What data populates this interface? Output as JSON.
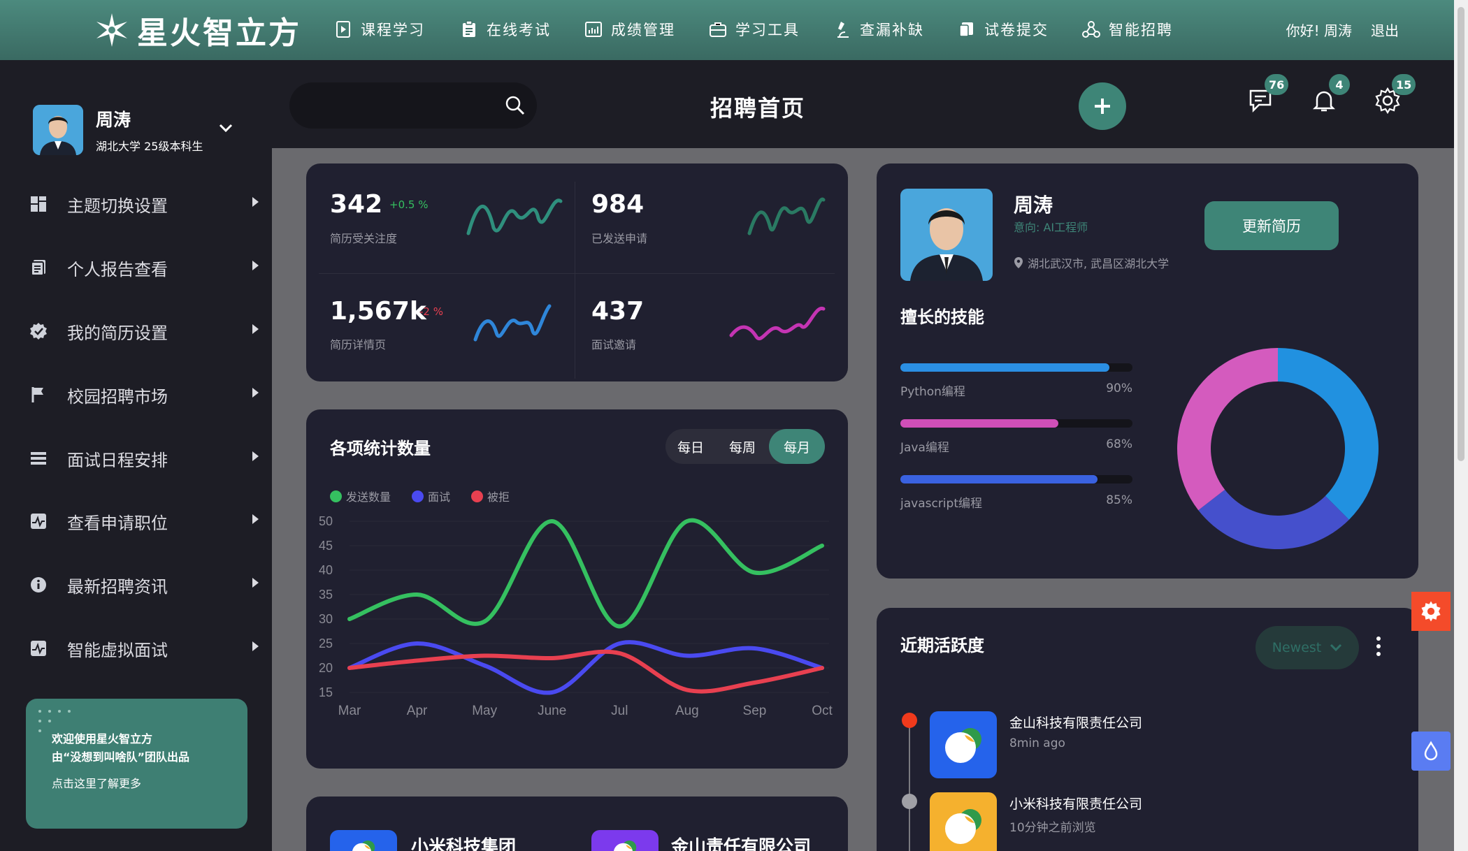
{
  "brand": {
    "name": "星火智立方"
  },
  "nav": {
    "items": [
      {
        "label": "课程学习",
        "icon": "play-doc-icon"
      },
      {
        "label": "在线考试",
        "icon": "clipboard-icon"
      },
      {
        "label": "成绩管理",
        "icon": "chart-icon"
      },
      {
        "label": "学习工具",
        "icon": "toolbox-icon"
      },
      {
        "label": "查漏补缺",
        "icon": "microscope-icon"
      },
      {
        "label": "试卷提交",
        "icon": "submit-icon"
      },
      {
        "label": "智能招聘",
        "icon": "network-icon"
      }
    ],
    "greeting": "你好! 周涛",
    "logout": "退出"
  },
  "sidebar": {
    "user": {
      "name": "周涛",
      "school": "湖北大学 25级本科生"
    },
    "items": [
      {
        "label": "主题切换设置",
        "icon": "grid-icon"
      },
      {
        "label": "个人报告查看",
        "icon": "document-icon"
      },
      {
        "label": "我的简历设置",
        "icon": "badge-check-icon"
      },
      {
        "label": "校园招聘市场",
        "icon": "flag-icon"
      },
      {
        "label": "面试日程安排",
        "icon": "list-icon"
      },
      {
        "label": "查看申请职位",
        "icon": "activity-icon"
      },
      {
        "label": "最新招聘资讯",
        "icon": "info-icon"
      },
      {
        "label": "智能虚拟面试",
        "icon": "activity-icon"
      }
    ],
    "promo": {
      "line1": "欢迎使用星火智立方",
      "line2": "由“没想到叫啥队”团队出品",
      "line3": "点击这里了解更多"
    }
  },
  "header": {
    "search_placeholder": "",
    "title": "招聘首页",
    "badges": {
      "messages": "76",
      "notifications": "4",
      "settings": "15"
    }
  },
  "stats": [
    {
      "value": "342",
      "delta": "+0.5 %",
      "label": "简历受关注度",
      "color": "#2f8f7d"
    },
    {
      "value": "984",
      "delta": "",
      "label": "已发送申请",
      "color": "#2a7a63"
    },
    {
      "value": "1,567k",
      "delta": "-2 %",
      "label": "简历详情页",
      "color": "#2f86d9"
    },
    {
      "value": "437",
      "delta": "",
      "label": "面试邀请",
      "color": "#c434b3"
    }
  ],
  "chart_card": {
    "title": "各项统计数量",
    "tabs": [
      "每日",
      "每周",
      "每月"
    ],
    "active_tab": "每月"
  },
  "chart_data": {
    "type": "line",
    "categories": [
      "Mar",
      "Apr",
      "May",
      "June",
      "Jul",
      "Aug",
      "Sep",
      "Oct"
    ],
    "yticks": [
      50,
      45,
      40,
      35,
      30,
      25,
      20,
      15
    ],
    "ylim": [
      15,
      50
    ],
    "grid": true,
    "legend_position": "top-left",
    "series": [
      {
        "name": "发送数量",
        "color": "#35c060",
        "values": [
          30,
          35,
          29.5,
          50,
          28.5,
          50,
          39.5,
          45
        ]
      },
      {
        "name": "面试",
        "color": "#4a4af0",
        "values": [
          20,
          25,
          20.5,
          15,
          25,
          22.5,
          24,
          20
        ]
      },
      {
        "name": "被拒",
        "color": "#e84050",
        "values": [
          20,
          21.5,
          22.5,
          22,
          23,
          15.5,
          17,
          20
        ]
      }
    ]
  },
  "resume": {
    "name": "周涛",
    "intent": "意向: AI工程师",
    "location": "湖北武汉市, 武昌区湖北大学",
    "update_button": "更新简历",
    "skills_title": "擅长的技能",
    "skills": [
      {
        "name": "Python编程",
        "pct_text": "90%",
        "pct": 0.9,
        "color": "#2b8fe3"
      },
      {
        "name": "Java编程",
        "pct_text": "68%",
        "pct": 0.68,
        "color": "#d04fb8"
      },
      {
        "name": "javascript编程",
        "pct_text": "85%",
        "pct": 0.85,
        "color": "#3a62e0"
      }
    ],
    "donut": [
      {
        "value": 0.375,
        "color": "#2191e0"
      },
      {
        "value": 0.27,
        "color": "#4550cc"
      },
      {
        "value": 0.355,
        "color": "#d45bbe"
      }
    ]
  },
  "activity": {
    "title": "近期活跃度",
    "sort": "Newest",
    "items": [
      {
        "company": "金山科技有限责任公司",
        "time": "8min ago",
        "dot": "#f03a1c",
        "logo_color": "#2563eb"
      },
      {
        "company": "小米科技有限责任公司",
        "time": "10分钟之前浏览",
        "dot": "#a0a0a6",
        "logo_color": "#f5b12e"
      }
    ]
  },
  "companies": [
    {
      "name": "小米科技集团",
      "logo_color": "#2563eb"
    },
    {
      "name": "金山责任有限公司",
      "logo_color": "#7c3aed"
    }
  ]
}
